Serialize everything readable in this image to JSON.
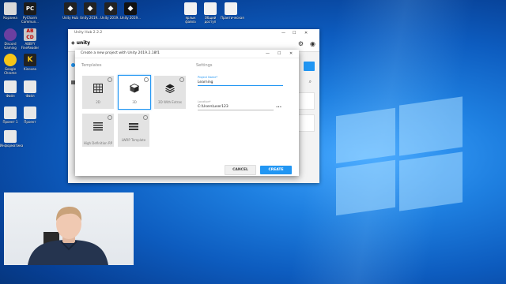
{
  "desktop": {
    "icons": [
      {
        "label": "Корзина",
        "color": "#d9d9d9"
      },
      {
        "label": "PyCharm Commun...",
        "color": "#1b1b1b"
      },
      {
        "label": "Unity Hub",
        "color": "#222222"
      },
      {
        "label": "Unity 2019...",
        "color": "#222222"
      },
      {
        "label": "Unity 2019...",
        "color": "#222222"
      },
      {
        "label": "Unity 2019...",
        "color": "#111111"
      },
      {
        "label": "ярлык файла",
        "color": "#f2f2f2"
      },
      {
        "label": "Общий доступ",
        "color": "#f2f2f2"
      },
      {
        "label": "Практическая",
        "color": "#f2f2f2"
      },
      {
        "label": "Discord Gaming",
        "color": "#6b3fa0"
      },
      {
        "label": "ABBYY FineReader",
        "color": "#c8c8c8"
      },
      {
        "label": "Google Chrome",
        "color": "#f5c518"
      },
      {
        "label": "Kinovea",
        "color": "#f5c518"
      },
      {
        "label": "Файл",
        "color": "#e8e8e8"
      },
      {
        "label": "Файл",
        "color": "#e8e8e8"
      },
      {
        "label": "Проект 1",
        "color": "#e8e8e8"
      },
      {
        "label": "Проект",
        "color": "#e8e8e8"
      },
      {
        "label": "Информатика",
        "color": "#e8e8e8"
      }
    ]
  },
  "hub": {
    "title": "Unity Hub 2.2.2",
    "logo": "unity",
    "controls": [
      "—",
      "☐",
      "✕"
    ]
  },
  "dialog": {
    "title": "Create a new project with Unity 2019.2.18f1",
    "controls": [
      "—",
      "☐",
      "✕"
    ],
    "templates_heading": "Templates",
    "settings_heading": "Settings",
    "templates": [
      {
        "name": "2D",
        "icon": "grid-icon",
        "selected": false
      },
      {
        "name": "3D",
        "icon": "cube-icon",
        "selected": true
      },
      {
        "name": "3D With Extras",
        "icon": "layers-icon",
        "selected": false
      },
      {
        "name": "High Definition RP",
        "icon": "hdrp-icon",
        "selected": false
      },
      {
        "name": "LWRP Template",
        "icon": "lwrp-icon",
        "selected": false
      }
    ],
    "project_name_label": "Project Name*",
    "project_name_value": "Learning",
    "location_label": "Location*",
    "location_value": "C:\\Users\\user123",
    "location_more": "•••",
    "cancel_label": "CANCEL",
    "create_label": "CREATE"
  },
  "colors": {
    "accent": "#2196f3",
    "desktop_bg": "#0d5cbf"
  }
}
